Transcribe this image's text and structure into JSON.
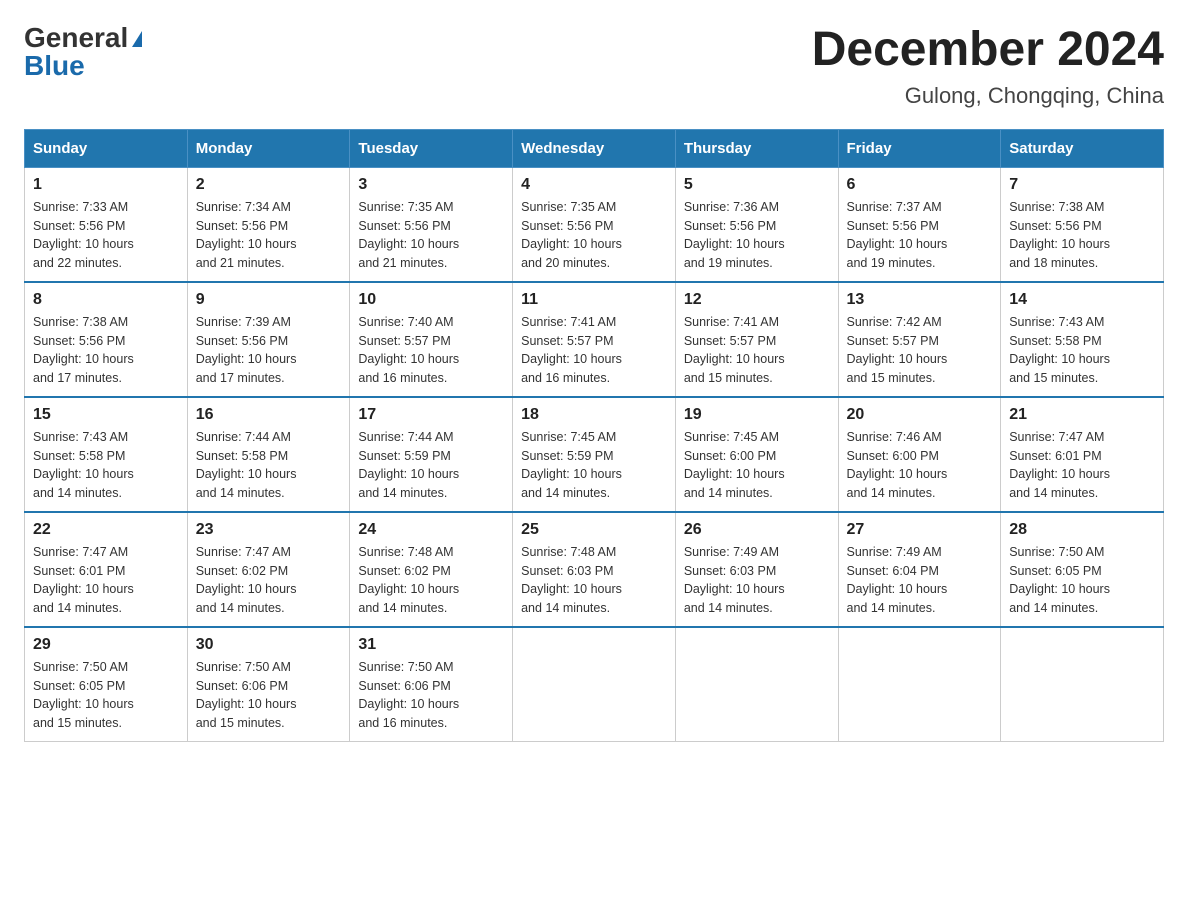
{
  "header": {
    "logo_general": "General",
    "logo_blue": "Blue",
    "month_title": "December 2024",
    "location": "Gulong, Chongqing, China"
  },
  "weekdays": [
    "Sunday",
    "Monday",
    "Tuesday",
    "Wednesday",
    "Thursday",
    "Friday",
    "Saturday"
  ],
  "weeks": [
    [
      {
        "day": "1",
        "sunrise": "7:33 AM",
        "sunset": "5:56 PM",
        "daylight": "10 hours and 22 minutes."
      },
      {
        "day": "2",
        "sunrise": "7:34 AM",
        "sunset": "5:56 PM",
        "daylight": "10 hours and 21 minutes."
      },
      {
        "day": "3",
        "sunrise": "7:35 AM",
        "sunset": "5:56 PM",
        "daylight": "10 hours and 21 minutes."
      },
      {
        "day": "4",
        "sunrise": "7:35 AM",
        "sunset": "5:56 PM",
        "daylight": "10 hours and 20 minutes."
      },
      {
        "day": "5",
        "sunrise": "7:36 AM",
        "sunset": "5:56 PM",
        "daylight": "10 hours and 19 minutes."
      },
      {
        "day": "6",
        "sunrise": "7:37 AM",
        "sunset": "5:56 PM",
        "daylight": "10 hours and 19 minutes."
      },
      {
        "day": "7",
        "sunrise": "7:38 AM",
        "sunset": "5:56 PM",
        "daylight": "10 hours and 18 minutes."
      }
    ],
    [
      {
        "day": "8",
        "sunrise": "7:38 AM",
        "sunset": "5:56 PM",
        "daylight": "10 hours and 17 minutes."
      },
      {
        "day": "9",
        "sunrise": "7:39 AM",
        "sunset": "5:56 PM",
        "daylight": "10 hours and 17 minutes."
      },
      {
        "day": "10",
        "sunrise": "7:40 AM",
        "sunset": "5:57 PM",
        "daylight": "10 hours and 16 minutes."
      },
      {
        "day": "11",
        "sunrise": "7:41 AM",
        "sunset": "5:57 PM",
        "daylight": "10 hours and 16 minutes."
      },
      {
        "day": "12",
        "sunrise": "7:41 AM",
        "sunset": "5:57 PM",
        "daylight": "10 hours and 15 minutes."
      },
      {
        "day": "13",
        "sunrise": "7:42 AM",
        "sunset": "5:57 PM",
        "daylight": "10 hours and 15 minutes."
      },
      {
        "day": "14",
        "sunrise": "7:43 AM",
        "sunset": "5:58 PM",
        "daylight": "10 hours and 15 minutes."
      }
    ],
    [
      {
        "day": "15",
        "sunrise": "7:43 AM",
        "sunset": "5:58 PM",
        "daylight": "10 hours and 14 minutes."
      },
      {
        "day": "16",
        "sunrise": "7:44 AM",
        "sunset": "5:58 PM",
        "daylight": "10 hours and 14 minutes."
      },
      {
        "day": "17",
        "sunrise": "7:44 AM",
        "sunset": "5:59 PM",
        "daylight": "10 hours and 14 minutes."
      },
      {
        "day": "18",
        "sunrise": "7:45 AM",
        "sunset": "5:59 PM",
        "daylight": "10 hours and 14 minutes."
      },
      {
        "day": "19",
        "sunrise": "7:45 AM",
        "sunset": "6:00 PM",
        "daylight": "10 hours and 14 minutes."
      },
      {
        "day": "20",
        "sunrise": "7:46 AM",
        "sunset": "6:00 PM",
        "daylight": "10 hours and 14 minutes."
      },
      {
        "day": "21",
        "sunrise": "7:47 AM",
        "sunset": "6:01 PM",
        "daylight": "10 hours and 14 minutes."
      }
    ],
    [
      {
        "day": "22",
        "sunrise": "7:47 AM",
        "sunset": "6:01 PM",
        "daylight": "10 hours and 14 minutes."
      },
      {
        "day": "23",
        "sunrise": "7:47 AM",
        "sunset": "6:02 PM",
        "daylight": "10 hours and 14 minutes."
      },
      {
        "day": "24",
        "sunrise": "7:48 AM",
        "sunset": "6:02 PM",
        "daylight": "10 hours and 14 minutes."
      },
      {
        "day": "25",
        "sunrise": "7:48 AM",
        "sunset": "6:03 PM",
        "daylight": "10 hours and 14 minutes."
      },
      {
        "day": "26",
        "sunrise": "7:49 AM",
        "sunset": "6:03 PM",
        "daylight": "10 hours and 14 minutes."
      },
      {
        "day": "27",
        "sunrise": "7:49 AM",
        "sunset": "6:04 PM",
        "daylight": "10 hours and 14 minutes."
      },
      {
        "day": "28",
        "sunrise": "7:50 AM",
        "sunset": "6:05 PM",
        "daylight": "10 hours and 14 minutes."
      }
    ],
    [
      {
        "day": "29",
        "sunrise": "7:50 AM",
        "sunset": "6:05 PM",
        "daylight": "10 hours and 15 minutes."
      },
      {
        "day": "30",
        "sunrise": "7:50 AM",
        "sunset": "6:06 PM",
        "daylight": "10 hours and 15 minutes."
      },
      {
        "day": "31",
        "sunrise": "7:50 AM",
        "sunset": "6:06 PM",
        "daylight": "10 hours and 16 minutes."
      },
      null,
      null,
      null,
      null
    ]
  ],
  "labels": {
    "sunrise": "Sunrise:",
    "sunset": "Sunset:",
    "daylight": "Daylight:"
  }
}
